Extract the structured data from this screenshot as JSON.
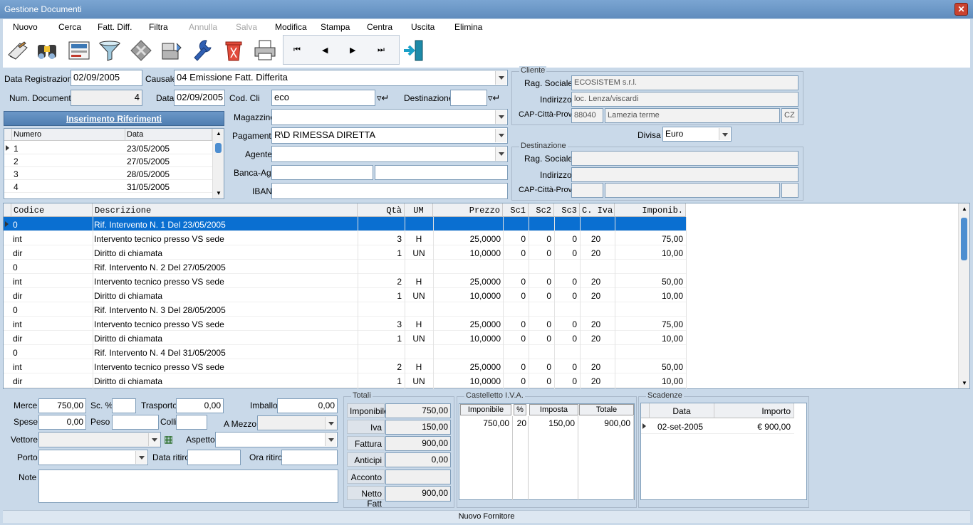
{
  "window": {
    "title": "Gestione Documenti"
  },
  "menu": [
    "Nuovo",
    "Cerca",
    "Fatt. Diff.",
    "Filtra",
    "Annulla",
    "Salva",
    "Modifica",
    "Stampa",
    "Centra",
    "Uscita",
    "Elimina"
  ],
  "menu_disabled": [
    "Annulla",
    "Salva"
  ],
  "toolbar": [
    "new-document-icon",
    "search-binoculars-icon",
    "deferred-invoice-icon",
    "filter-funnel-icon",
    "cancel-icon",
    "save-icon",
    "edit-wrench-icon",
    "delete-trash-icon",
    "print-printer-icon"
  ],
  "nav": {
    "first": "⏮",
    "prev": "◀",
    "next": "▶",
    "last": "⏭"
  },
  "header": {
    "data_registrazione_label": "Data Registrazione",
    "data_registrazione": "02/09/2005",
    "causale_label": "Causale",
    "causale": "04 Emissione Fatt. Differita",
    "num_documento_label": "Num. Documento",
    "num_documento": "4",
    "data_label": "Data",
    "data": "02/09/2005",
    "cod_cli_label": "Cod. Cli",
    "cod_cli": "eco",
    "destinazione_label": "Destinazione",
    "destinazione": "",
    "magazzino_label": "Magazzino",
    "magazzino": "",
    "pagamento_label": "Pagamento",
    "pagamento": "R\\D RIMESSA DIRETTA",
    "agente_label": "Agente",
    "agente": "",
    "banca_label": "Banca-Ag.",
    "iban_label": "IBAN",
    "divisa_label": "Divisa",
    "divisa": "Euro"
  },
  "cliente": {
    "caption": "Cliente",
    "rag_sociale_label": "Rag. Sociale",
    "rag_sociale": "ECOSISTEM s.r.l.",
    "indirizzo_label": "Indirizzo",
    "indirizzo": "loc. Lenza/viscardi",
    "cap_label": "CAP-Città-Prov",
    "cap": "88040",
    "citta": "Lamezia terme",
    "prov": "CZ"
  },
  "destinazione": {
    "caption": "Destinazione",
    "rag_sociale_label": "Rag. Sociale",
    "indirizzo_label": "Indirizzo",
    "cap_label": "CAP-Città-Prov"
  },
  "riferimenti": {
    "button": "Inserimento Riferimenti",
    "columns": [
      "Numero",
      "Data"
    ],
    "rows": [
      [
        "1",
        "23/05/2005"
      ],
      [
        "2",
        "27/05/2005"
      ],
      [
        "3",
        "28/05/2005"
      ],
      [
        "4",
        "31/05/2005"
      ]
    ]
  },
  "righe": {
    "columns": [
      "Codice",
      "Descrizione",
      "Qtà",
      "UM",
      "Prezzo",
      "Sc1",
      "Sc2",
      "Sc3",
      "C. Iva",
      "Imponib."
    ],
    "rows": [
      [
        "0",
        "Rif. Intervento N. 1 Del 23/05/2005",
        "",
        "",
        "",
        "",
        "",
        "",
        "",
        ""
      ],
      [
        "int",
        "Intervento tecnico presso VS sede",
        "3",
        "H",
        "25,0000",
        "0",
        "0",
        "0",
        "20",
        "75,00"
      ],
      [
        "dir",
        "Diritto di chiamata",
        "1",
        "UN",
        "10,0000",
        "0",
        "0",
        "0",
        "20",
        "10,00"
      ],
      [
        "0",
        "Rif. Intervento N. 2 Del 27/05/2005",
        "",
        "",
        "",
        "",
        "",
        "",
        "",
        ""
      ],
      [
        "int",
        "Intervento tecnico presso VS sede",
        "2",
        "H",
        "25,0000",
        "0",
        "0",
        "0",
        "20",
        "50,00"
      ],
      [
        "dir",
        "Diritto di chiamata",
        "1",
        "UN",
        "10,0000",
        "0",
        "0",
        "0",
        "20",
        "10,00"
      ],
      [
        "0",
        "Rif. Intervento N. 3 Del 28/05/2005",
        "",
        "",
        "",
        "",
        "",
        "",
        "",
        ""
      ],
      [
        "int",
        "Intervento tecnico presso VS sede",
        "3",
        "H",
        "25,0000",
        "0",
        "0",
        "0",
        "20",
        "75,00"
      ],
      [
        "dir",
        "Diritto di chiamata",
        "1",
        "UN",
        "10,0000",
        "0",
        "0",
        "0",
        "20",
        "10,00"
      ],
      [
        "0",
        "Rif. Intervento N. 4 Del 31/05/2005",
        "",
        "",
        "",
        "",
        "",
        "",
        "",
        ""
      ],
      [
        "int",
        "Intervento tecnico presso VS sede",
        "2",
        "H",
        "25,0000",
        "0",
        "0",
        "0",
        "20",
        "50,00"
      ],
      [
        "dir",
        "Diritto di chiamata",
        "1",
        "UN",
        "10,0000",
        "0",
        "0",
        "0",
        "20",
        "10,00"
      ]
    ]
  },
  "footer": {
    "merce_label": "Merce",
    "merce": "750,00",
    "sc_label": "Sc. %",
    "sc": "",
    "trasporto_label": "Trasporto",
    "trasporto": "0,00",
    "imballo_label": "Imballo",
    "imballo": "0,00",
    "spese_label": "Spese",
    "spese": "0,00",
    "peso_label": "Peso",
    "peso": "",
    "colli_label": "Colli",
    "colli": "",
    "amezzo_label": "A Mezzo",
    "amezzo": "",
    "vettore_label": "Vettore",
    "vettore": "",
    "aspetto_label": "Aspetto",
    "aspetto": "",
    "porto_label": "Porto",
    "porto": "",
    "data_ritiro_label": "Data ritiro",
    "data_ritiro": "",
    "ora_ritiro_label": "Ora ritiro",
    "ora_ritiro": "",
    "note_label": "Note",
    "note": ""
  },
  "totali": {
    "caption": "Totali",
    "rows": [
      [
        "Imponibile",
        "750,00"
      ],
      [
        "Iva",
        "150,00"
      ],
      [
        "Fattura",
        "900,00"
      ],
      [
        "Anticipi",
        "0,00"
      ],
      [
        "Acconto",
        ""
      ],
      [
        "Netto Fatt",
        "900,00"
      ]
    ]
  },
  "castelletto": {
    "caption": "Castelletto I.V.A.",
    "columns": [
      "Imponibile",
      "%",
      "Imposta",
      "Totale"
    ],
    "values": [
      "750,00",
      "20",
      "150,00",
      "900,00"
    ]
  },
  "scadenze": {
    "caption": "Scadenze",
    "columns": [
      "Data",
      "Importo"
    ],
    "rows": [
      [
        "02-set-2005",
        "€ 900,00"
      ]
    ]
  },
  "status": "Nuovo Fornitore"
}
